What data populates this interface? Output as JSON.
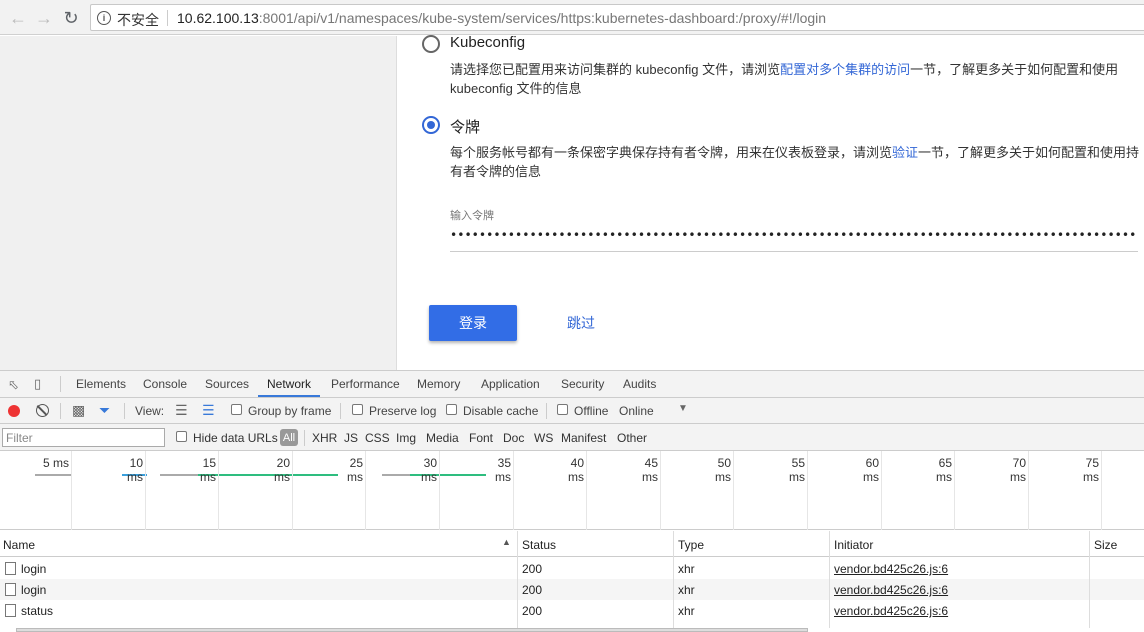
{
  "browser": {
    "insecure_label": "不安全",
    "url_host": "10.62.100.13",
    "url_rest": ":8001/api/v1/namespaces/kube-system/services/https:kubernetes-dashboard:/proxy/#!/login"
  },
  "login": {
    "kubeconfig": {
      "title": "Kubeconfig",
      "desc_pre": "请选择您已配置用来访问集群的 kubeconfig 文件，请浏览",
      "desc_link": "配置对多个集群的访问",
      "desc_post": "一节，了解更多关于如何配置和使用 kubeconfig 文件的信息",
      "selected": false
    },
    "token": {
      "title": "令牌",
      "desc_pre": "每个服务帐号都有一条保密字典保存持有者令牌，用来在仪表板登录，请浏览",
      "desc_link": "验证",
      "desc_post": "一节，了解更多关于如何配置和使用持有者令牌的信息",
      "selected": true
    },
    "token_label": "输入令牌",
    "token_value": "••••••••••••••••••••••••••••••••••••••••••••••••••••••••••••••••••••••••••••••••••••••••••••••••••••••••••••••••••••••••",
    "login_button": "登录",
    "skip_button": "跳过"
  },
  "devtools": {
    "tabs": [
      "Elements",
      "Console",
      "Sources",
      "Network",
      "Performance",
      "Memory",
      "Application",
      "Security",
      "Audits"
    ],
    "active_tab": "Network",
    "toolbar": {
      "view_label": "View:",
      "group_by_frame": "Group by frame",
      "preserve_log": "Preserve log",
      "disable_cache": "Disable cache",
      "offline": "Offline",
      "throttle": "Online"
    },
    "filter": {
      "placeholder": "Filter",
      "hide_data_urls": "Hide data URLs",
      "all": "All",
      "types": [
        "XHR",
        "JS",
        "CSS",
        "Img",
        "Media",
        "Font",
        "Doc",
        "WS",
        "Manifest",
        "Other"
      ]
    },
    "timeline_ticks": [
      "5 ms",
      "10 ms",
      "15 ms",
      "20 ms",
      "25 ms",
      "30 ms",
      "35 ms",
      "40 ms",
      "45 ms",
      "50 ms",
      "55 ms",
      "60 ms",
      "65 ms",
      "70 ms",
      "75 ms"
    ],
    "columns": [
      "Name",
      "Status",
      "Type",
      "Initiator",
      "Size"
    ],
    "rows": [
      {
        "name": "login",
        "status": "200",
        "type": "xhr",
        "initiator": "vendor.bd425c26.js:6"
      },
      {
        "name": "login",
        "status": "200",
        "type": "xhr",
        "initiator": "vendor.bd425c26.js:6"
      },
      {
        "name": "status",
        "status": "200",
        "type": "xhr",
        "initiator": "vendor.bd425c26.js:6"
      }
    ],
    "colors": {
      "record": "#e33333",
      "accent": "#3879d9",
      "bar_green": "#2ebd7f",
      "bar_blue": "#3aa0dd"
    }
  }
}
